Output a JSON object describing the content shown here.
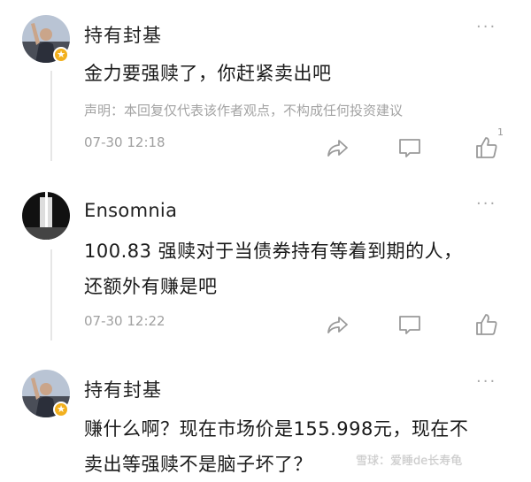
{
  "comments": [
    {
      "username": "持有封基",
      "text_lines": [
        "金力要强赎了，你赶紧卖出吧"
      ],
      "disclaimer": "声明：本回复仅代表该作者观点，不构成任何投资建议",
      "timestamp": "07-30 12:18",
      "like_count": "1",
      "more": "···"
    },
    {
      "username": "Ensomnia",
      "text_lines": [
        "100.83 强赎对于当债券持有等着到期的人，",
        "还额外有赚是吧"
      ],
      "timestamp": "07-30 12:22",
      "more": "···"
    },
    {
      "username": "持有封基",
      "text_lines": [
        "赚什么啊？现在市场价是155.998元，现在不",
        "卖出等强赎不是脑子坏了？"
      ],
      "more": "···"
    }
  ],
  "icons": {
    "share": "share-icon",
    "comment": "comment-icon",
    "like": "thumbs-up-icon",
    "more": "more-dots-icon",
    "badge": "star-badge-icon"
  },
  "watermark": "雪球：爱睡de长寿龟",
  "colors": {
    "text": "#1a1a1a",
    "muted": "#a0a0a0",
    "badge": "#f2b01e",
    "divider": "#e6e6e6"
  }
}
